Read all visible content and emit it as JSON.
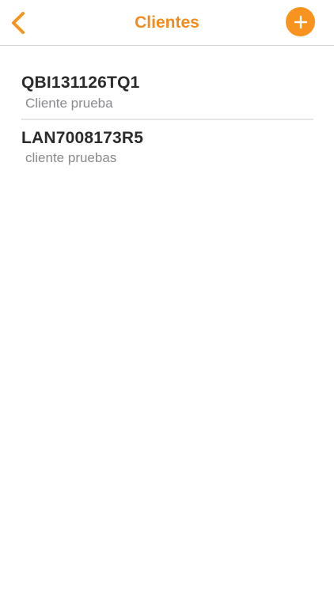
{
  "colors": {
    "accent": "#F7931E",
    "title": "#F28C1E",
    "text_primary": "#2B2B2B",
    "text_secondary": "#8A8A8E",
    "divider": "#E6E6E6"
  },
  "navbar": {
    "title": "Clientes",
    "back_icon": "chevron-left-icon",
    "add_icon": "plus-circle-icon"
  },
  "clients": [
    {
      "id": "QBI131126TQ1",
      "description": "Cliente prueba"
    },
    {
      "id": "LAN7008173R5",
      "description": "cliente pruebas"
    }
  ]
}
